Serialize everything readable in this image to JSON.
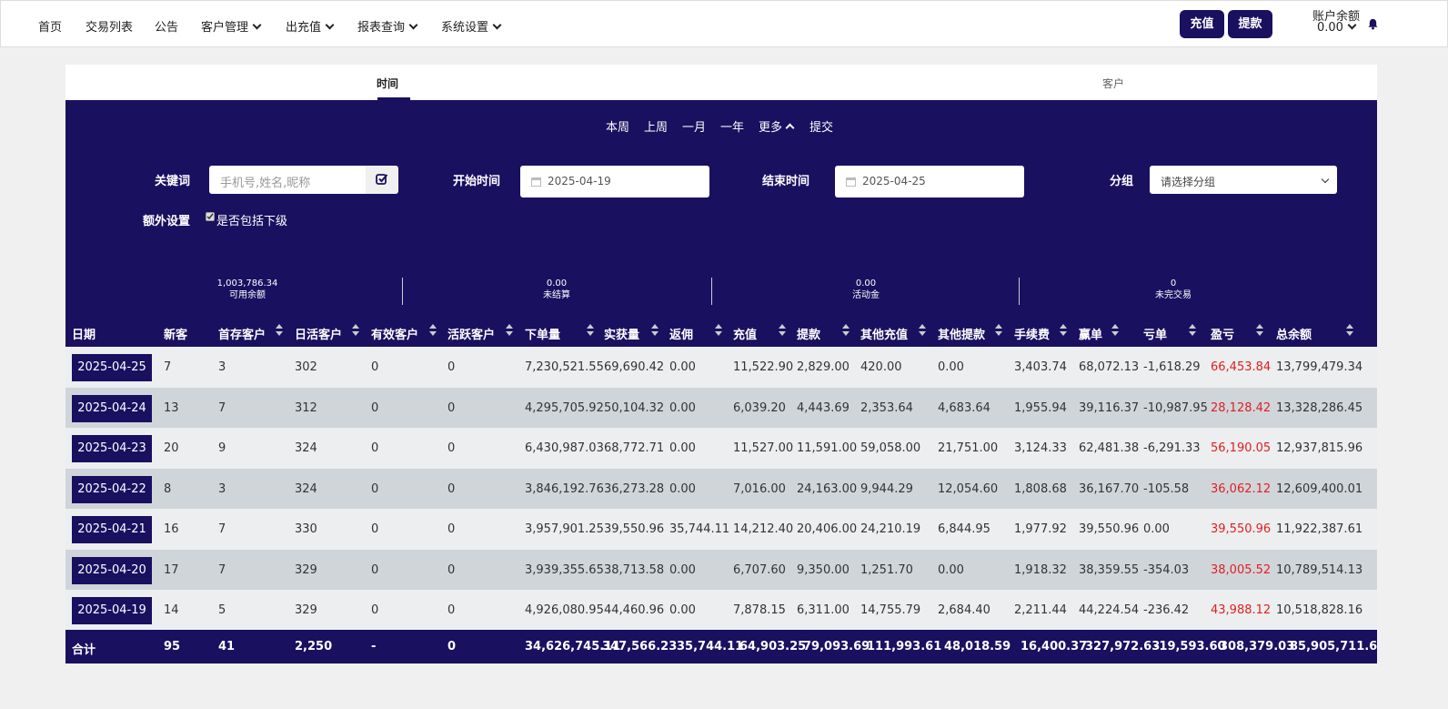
{
  "nav": {
    "items": [
      {
        "label": "首页",
        "dropdown": false
      },
      {
        "label": "交易列表",
        "dropdown": false
      },
      {
        "label": "公告",
        "dropdown": false
      },
      {
        "label": "客户管理",
        "dropdown": true
      },
      {
        "label": "出充值",
        "dropdown": true
      },
      {
        "label": "报表查询",
        "dropdown": true
      },
      {
        "label": "系统设置",
        "dropdown": true
      }
    ],
    "deposit_label": "充值",
    "withdraw_label": "提款",
    "balance_label": "账户余额",
    "balance_value": "0.00"
  },
  "tabs": [
    {
      "label": "时间",
      "active": true
    },
    {
      "label": "客户",
      "active": false
    }
  ],
  "quick_ranges": [
    "本周",
    "上周",
    "一月",
    "一年",
    "更多",
    "提交"
  ],
  "filters": {
    "keyword_label": "关键词",
    "keyword_placeholder": "手机号,姓名,昵称",
    "start_label": "开始时间",
    "start_value": "2025-04-19",
    "end_label": "结束时间",
    "end_value": "2025-04-25",
    "group_label": "分组",
    "group_value": "请选择分组",
    "extra_label": "额外设置",
    "include_sub_label": "是否包括下级"
  },
  "stats": [
    {
      "value": "1,003,786.34",
      "label": "可用余额"
    },
    {
      "value": "0.00",
      "label": "未结算"
    },
    {
      "value": "0.00",
      "label": "活动金"
    },
    {
      "value": "0",
      "label": "未完交易"
    }
  ],
  "table": {
    "headers": [
      "日期",
      "新客",
      "首存客户",
      "日活客户",
      "有效客户",
      "活跃客户",
      "下单量",
      "实获量",
      "返佣",
      "充值",
      "提款",
      "其他充值",
      "其他提款",
      "手续费",
      "赢单",
      "亏单",
      "盈亏",
      "总余额"
    ],
    "rows": [
      [
        "2025-04-25",
        "7",
        "3",
        "302",
        "0",
        "0",
        "7,230,521.55",
        "69,690.42",
        "0.00",
        "11,522.90",
        "2,829.00",
        "420.00",
        "0.00",
        "3,403.74",
        "68,072.13",
        "-1,618.29",
        "66,453.84",
        "13,799,479.34"
      ],
      [
        "2025-04-24",
        "13",
        "7",
        "312",
        "0",
        "0",
        "4,295,705.92",
        "50,104.32",
        "0.00",
        "6,039.20",
        "4,443.69",
        "2,353.64",
        "4,683.64",
        "1,955.94",
        "39,116.37",
        "-10,987.95",
        "28,128.42",
        "13,328,286.45"
      ],
      [
        "2025-04-23",
        "20",
        "9",
        "324",
        "0",
        "0",
        "6,430,987.03",
        "68,772.71",
        "0.00",
        "11,527.00",
        "11,591.00",
        "59,058.00",
        "21,751.00",
        "3,124.33",
        "62,481.38",
        "-6,291.33",
        "56,190.05",
        "12,937,815.96"
      ],
      [
        "2025-04-22",
        "8",
        "3",
        "324",
        "0",
        "0",
        "3,846,192.76",
        "36,273.28",
        "0.00",
        "7,016.00",
        "24,163.00",
        "9,944.29",
        "12,054.60",
        "1,808.68",
        "36,167.70",
        "-105.58",
        "36,062.12",
        "12,609,400.01"
      ],
      [
        "2025-04-21",
        "16",
        "7",
        "330",
        "0",
        "0",
        "3,957,901.25",
        "39,550.96",
        "35,744.11",
        "14,212.40",
        "20,406.00",
        "24,210.19",
        "6,844.95",
        "1,977.92",
        "39,550.96",
        "0.00",
        "39,550.96",
        "11,922,387.61"
      ],
      [
        "2025-04-20",
        "17",
        "7",
        "329",
        "0",
        "0",
        "3,939,355.65",
        "38,713.58",
        "0.00",
        "6,707.60",
        "9,350.00",
        "1,251.70",
        "0.00",
        "1,918.32",
        "38,359.55",
        "-354.03",
        "38,005.52",
        "10,789,514.13"
      ],
      [
        "2025-04-19",
        "14",
        "5",
        "329",
        "0",
        "0",
        "4,926,080.95",
        "44,460.96",
        "0.00",
        "7,878.15",
        "6,311.00",
        "14,755.79",
        "2,684.40",
        "2,211.44",
        "44,224.54",
        "-236.42",
        "43,988.12",
        "10,518,828.16"
      ]
    ],
    "totals": [
      "合计",
      "95",
      "41",
      "2,250",
      "-",
      "0",
      "34,626,745.11",
      "347,566.23",
      "35,744.11",
      "64,903.25",
      "79,093.69",
      "111,993.61",
      "48,018.59",
      "16,400.37",
      "327,972.63",
      "-19,593.60",
      "308,379.03",
      "85,905,711.6"
    ]
  },
  "colors": {
    "primary": "#1a1060",
    "profit_red": "#e02020",
    "row_light": "#eceef0",
    "row_dark": "#d0d5da"
  }
}
